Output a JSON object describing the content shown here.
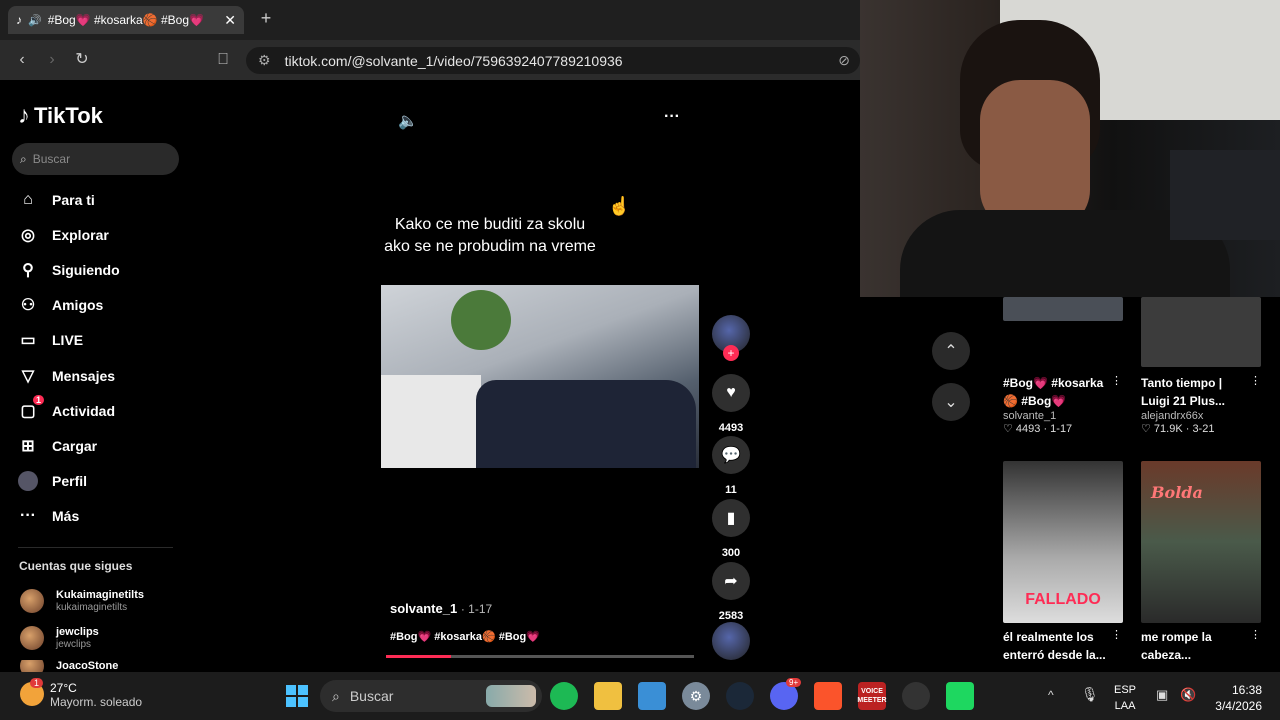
{
  "browser": {
    "tab_title": "#Bog💗 #kosarka🏀 #Bog💗",
    "new_tab": "+",
    "url": "tiktok.com/@solvante_1/video/7596392407789210936"
  },
  "sidebar": {
    "logo": "TikTok",
    "search_placeholder": "Buscar",
    "items": [
      {
        "label": "Para ti",
        "icon": "home-icon"
      },
      {
        "label": "Explorar",
        "icon": "compass-icon"
      },
      {
        "label": "Siguiendo",
        "icon": "user-follow-icon"
      },
      {
        "label": "Amigos",
        "icon": "friends-icon"
      },
      {
        "label": "LIVE",
        "icon": "live-icon"
      },
      {
        "label": "Mensajes",
        "icon": "send-icon"
      },
      {
        "label": "Actividad",
        "icon": "activity-icon",
        "badge": "1"
      },
      {
        "label": "Cargar",
        "icon": "upload-icon"
      },
      {
        "label": "Perfil",
        "icon": "avatar-icon"
      },
      {
        "label": "Más",
        "icon": "more-icon"
      }
    ],
    "following_title": "Cuentas que sigues",
    "accounts": [
      {
        "name": "Kukaimaginetilts",
        "handle": "kukaimaginetilts"
      },
      {
        "name": "jewclips",
        "handle": "jewclips"
      },
      {
        "name": "JoacoStone",
        "handle": ""
      }
    ]
  },
  "video": {
    "caption": "Kako ce me buditi za skolu ako se ne probudim na vreme",
    "author": "solvante_1",
    "date": "· 1-17",
    "hashtags": "#Bog💗 #kosarka🏀 #Bog💗",
    "progress": 0.21,
    "likes": "4493",
    "comments": "11",
    "saves": "300",
    "shares": "2583"
  },
  "grid": [
    {
      "title": "#Bog💗 #kosarka🏀 #Bog💗",
      "author": "solvante_1",
      "stats": "♡ 4493 · 1-17"
    },
    {
      "title": "Tanto tiempo | Luigi 21 Plus...",
      "author": "alejandrx66x",
      "stats": "♡ 71.9K · 3-21"
    },
    {
      "title": "él realmente los enterró desde la...",
      "overlay": "FALLADO",
      "author": "",
      "stats": ""
    },
    {
      "title": "me rompe la cabeza...",
      "overlay": "Bolda",
      "author": "",
      "stats": ""
    }
  ],
  "taskbar": {
    "weather_temp": "27°C",
    "weather_desc": "Mayorm. soleado",
    "weather_badge": "1",
    "search": "Buscar",
    "discord_badge": "9+",
    "voicemeeter": "VOICE MEETER",
    "lang_top": "ESP",
    "lang_bottom": "LAA",
    "time": "16:38",
    "date": "3/4/2026"
  },
  "colors": {
    "accent": "#fe2c55",
    "page_bg": "#000000",
    "chrome_bg": "#1f1f1f"
  }
}
